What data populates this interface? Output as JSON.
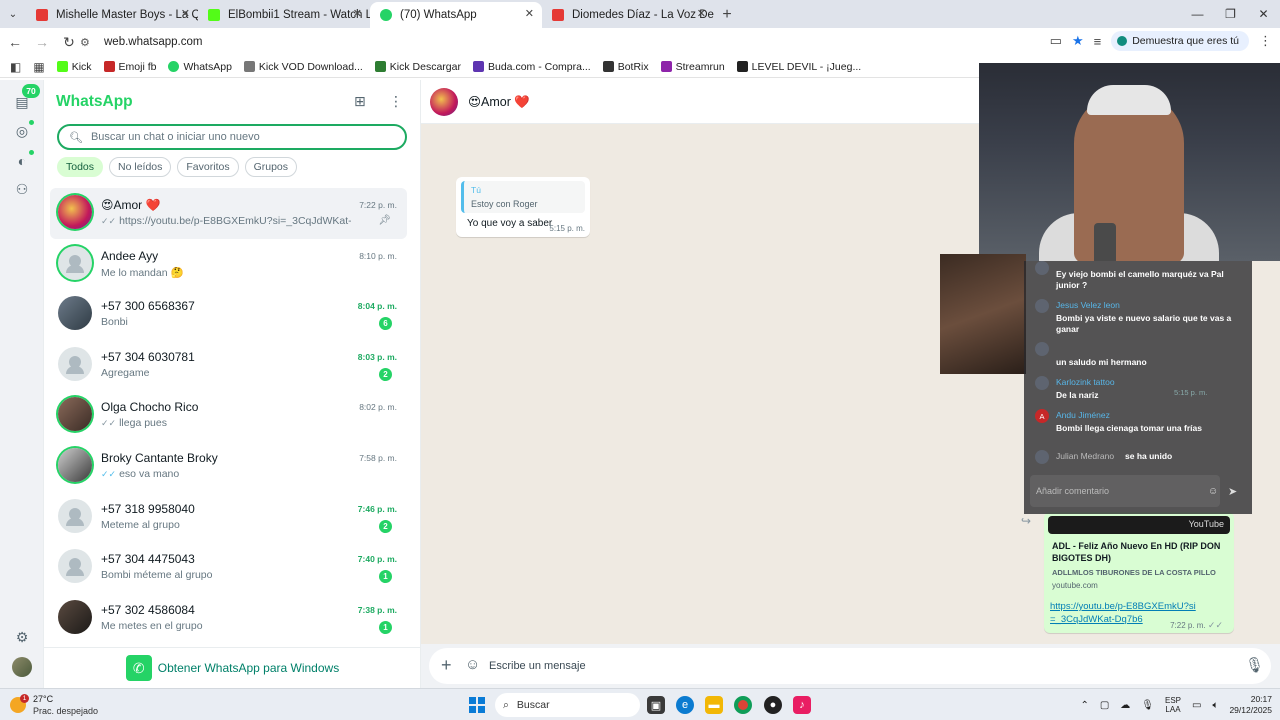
{
  "browser": {
    "tabs": [
      {
        "title": "Mishelle Master Boys - La Quer",
        "color": "#e53935",
        "active": false
      },
      {
        "title": "ElBombii1 Stream - Watch Live",
        "color": "#53fc18",
        "active": false
      },
      {
        "title": "(70) WhatsApp",
        "color": "#25d366",
        "active": true
      },
      {
        "title": "Diomedes Díaz - La Voz Del Pu",
        "color": "#e53935",
        "active": false
      }
    ],
    "url": "web.whatsapp.com",
    "verify_chip": "Demuestra que eres tú",
    "bookmarks": [
      {
        "label": "Kick",
        "color": "#53fc18"
      },
      {
        "label": "Emoji fb",
        "color": "#c62828"
      },
      {
        "label": "WhatsApp",
        "color": "#25d366"
      },
      {
        "label": "Kick VOD Download...",
        "color": "#777777"
      },
      {
        "label": "Kick Descargar",
        "color": "#2e7d32"
      },
      {
        "label": "Buda.com - Compra...",
        "color": "#5e35b1"
      },
      {
        "label": "BotRix",
        "color": "#333333"
      },
      {
        "label": "Streamrun",
        "color": "#8e24aa"
      },
      {
        "label": "LEVEL DEVIL - ¡Jueg...",
        "color": "#222222"
      }
    ]
  },
  "rail": {
    "unread_count": "70"
  },
  "sidebar": {
    "title": "WhatsApp",
    "search_placeholder": "Buscar un chat o iniciar uno nuevo",
    "filters": [
      "Todos",
      "No leídos",
      "Favoritos",
      "Grupos"
    ],
    "chats": [
      {
        "name": "😍Amor ❤️",
        "preview": "https://youtu.be/p-E8BGXEmkU?si=_3CqJdWKat-Dq7b6",
        "time": "7:22 p. m.",
        "unread": "",
        "ticks": "✓✓",
        "pinned": true
      },
      {
        "name": "Andee Ayy",
        "preview": "Me lo mandan 🤔",
        "time": "8:10 p. m.",
        "unread": "",
        "ticks": ""
      },
      {
        "name": "+57 300 6568367",
        "preview": "Bonbi",
        "time": "8:04 p. m.",
        "unread": "6",
        "ticks": ""
      },
      {
        "name": "+57 304 6030781",
        "preview": "Agregame",
        "time": "8:03 p. m.",
        "unread": "2",
        "ticks": ""
      },
      {
        "name": "Olga Chocho Rico",
        "preview": "llega pues",
        "time": "8:02 p. m.",
        "unread": "",
        "ticks": "✓✓"
      },
      {
        "name": "Broky Cantante Broky",
        "preview": "eso va mano",
        "time": "7:58 p. m.",
        "unread": "",
        "ticks": "✓✓"
      },
      {
        "name": "+57 318 9958040",
        "preview": "Meteme al grupo",
        "time": "7:46 p. m.",
        "unread": "2",
        "ticks": ""
      },
      {
        "name": "+57 304 4475043",
        "preview": "Bombi méteme al grupo",
        "time": "7:40 p. m.",
        "unread": "1",
        "ticks": ""
      },
      {
        "name": "+57 302 4586084",
        "preview": "Me metes en el grupo",
        "time": "7:38 p. m.",
        "unread": "1",
        "ticks": ""
      }
    ],
    "get_app": "Obtener WhatsApp para Windows"
  },
  "conversation": {
    "title": "😍Amor ❤️",
    "incoming": {
      "quote_author": "Tú",
      "quote_text": "Estoy con Roger",
      "text": "Yo que voy a saber",
      "time": "5:15 p. m."
    },
    "outgoing": {
      "preview_title": "ADL - Feliz Año Nuevo En HD (RIP DON BIGOTES DH)",
      "preview_subtitle": "ADLLMLOS TIBURONES DE LA COSTA PILLO",
      "preview_domain": "youtube.com",
      "thumb_label": "YouTube",
      "link": "https://youtu.be/p-E8BGXEmkU?si=_3CqJdWKat-Dq7b6",
      "time": "7:22 p. m."
    },
    "composer_placeholder": "Escribe un mensaje"
  },
  "stream_chat": {
    "messages": [
      {
        "user": "",
        "text": "Ey viejo bombi el camello marquéz va Pal junior ?"
      },
      {
        "user": "Jesus Velez leon",
        "text": "Bombi ya viste e nuevo salario que te vas a ganar"
      },
      {
        "user": "",
        "text": "un saludo mi hermano"
      },
      {
        "user": "Karlozink tattoo",
        "text": "De la nariz"
      },
      {
        "user": "Andu Jiménez",
        "text": "Bombi llega cienaga tomar una frías"
      },
      {
        "user": "Julian Medrano",
        "text": "se ha unido"
      }
    ],
    "input_placeholder": "Añadir comentario",
    "ghost_time": "5:15 p. m."
  },
  "taskbar": {
    "temp": "27°C",
    "weather": "Prac. despejado",
    "weather_badge": "1",
    "search": "Buscar",
    "lang_top": "ESP",
    "lang_bottom": "LAA",
    "time": "20:17",
    "date": "29/12/2025"
  }
}
